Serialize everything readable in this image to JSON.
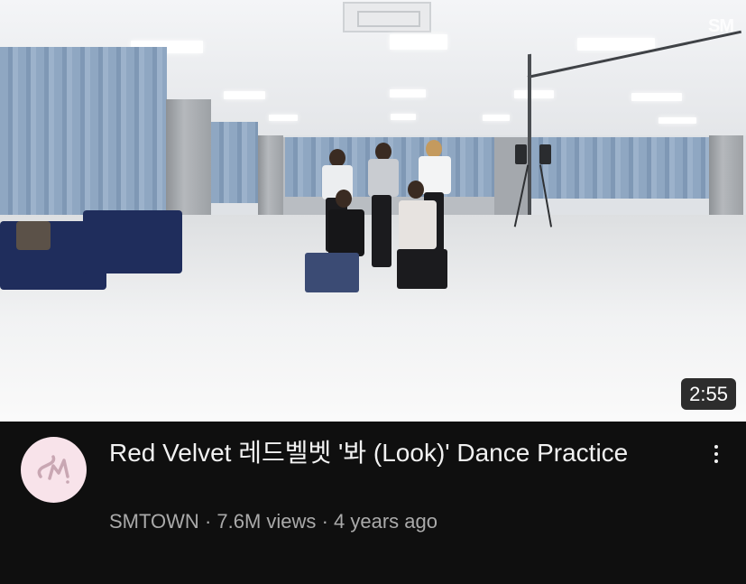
{
  "video": {
    "duration": "2:55",
    "watermark": "SM"
  },
  "details": {
    "title": "Red Velvet 레드벨벳 '봐 (Look)' Dance Practice",
    "channel": "SMTOWN",
    "separator": "·",
    "views": "7.6M views",
    "age": "4 years ago"
  },
  "icons": {
    "channel_avatar": "smtown-logo-icon",
    "more_menu": "more-vert-icon"
  },
  "colors": {
    "background": "#0f0f0f",
    "title_text": "#f1f1f1",
    "meta_text": "#aaaaaa",
    "avatar_bg": "#f8e3ea",
    "logo": "#c9a7b3"
  }
}
